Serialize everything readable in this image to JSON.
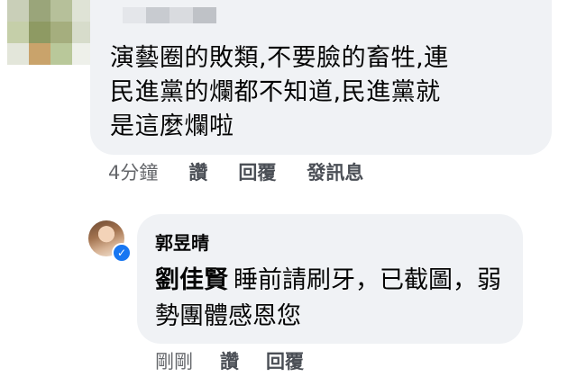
{
  "top_comment": {
    "text": "演藝圈的敗類,不要臉的畜牲,連\n民進黨的爛都不知道,民進黨就\n是這麼爛啦",
    "timestamp": "4分鐘",
    "actions": [
      "讚",
      "回覆",
      "發訊息"
    ]
  },
  "reply": {
    "author": "郭昱晴",
    "mention": "劉佳賢",
    "text": "睡前請刷牙，已截圖，弱勢團體感恩您",
    "timestamp": "剛剛",
    "actions": [
      "讚",
      "回覆"
    ],
    "verified": true
  },
  "colors": {
    "bubble_bg": "#f0f2f5",
    "action_text": "#4b4f56",
    "verified_badge": "#1877f2"
  }
}
